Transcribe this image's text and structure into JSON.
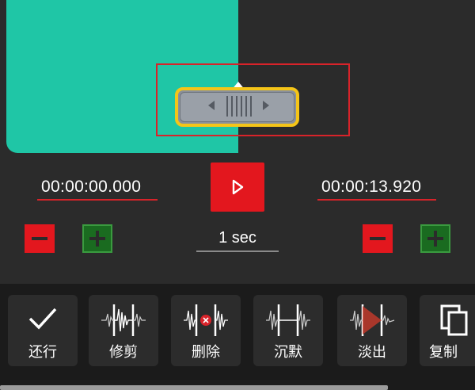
{
  "trim": {
    "start_time": "00:00:00.000",
    "end_time": "00:00:13.920",
    "step": "1 sec"
  },
  "toolbar": {
    "items": [
      {
        "label": "还行",
        "icon": "check-icon"
      },
      {
        "label": "修剪",
        "icon": "trim-icon"
      },
      {
        "label": "删除",
        "icon": "delete-segment-icon"
      },
      {
        "label": "沉默",
        "icon": "silence-icon"
      },
      {
        "label": "淡出",
        "icon": "fade-out-icon"
      },
      {
        "label": "复制",
        "icon": "copy-icon"
      }
    ]
  },
  "colors": {
    "selection": "#1fc6a6",
    "accent_red": "#e3171e",
    "handle_border": "#f5c518",
    "plus_green": "#1a6b20"
  }
}
